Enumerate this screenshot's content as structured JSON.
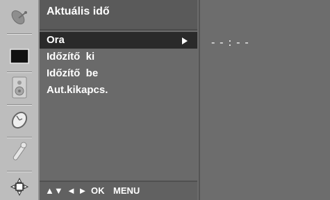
{
  "menu": {
    "title": "Aktuális idő",
    "items": [
      {
        "label": "Ora",
        "selected": true,
        "has_submenu": true
      },
      {
        "label": "Időzítő  ki",
        "selected": false
      },
      {
        "label": "Időzítő  be",
        "selected": false
      },
      {
        "label": "Aut.kikapcs.",
        "selected": false
      }
    ]
  },
  "footer": {
    "nav_up_down": "▲▼",
    "nav_left_right": "◄ ►",
    "ok": "OK",
    "menu": "MENU"
  },
  "panel": {
    "time_value": "- - : - -"
  },
  "rail": {
    "icons": [
      "satellite-dish-icon",
      "screen-icon",
      "speaker-icon",
      "clock-icon",
      "wrench-icon",
      "option-icon"
    ],
    "active_icon": "clock-icon"
  },
  "colors": {
    "menu_bg": "#6a6a6a",
    "selected_bg": "#2a2a2a",
    "rail_bg": "#bdbdbd",
    "text": "#ffffff"
  }
}
